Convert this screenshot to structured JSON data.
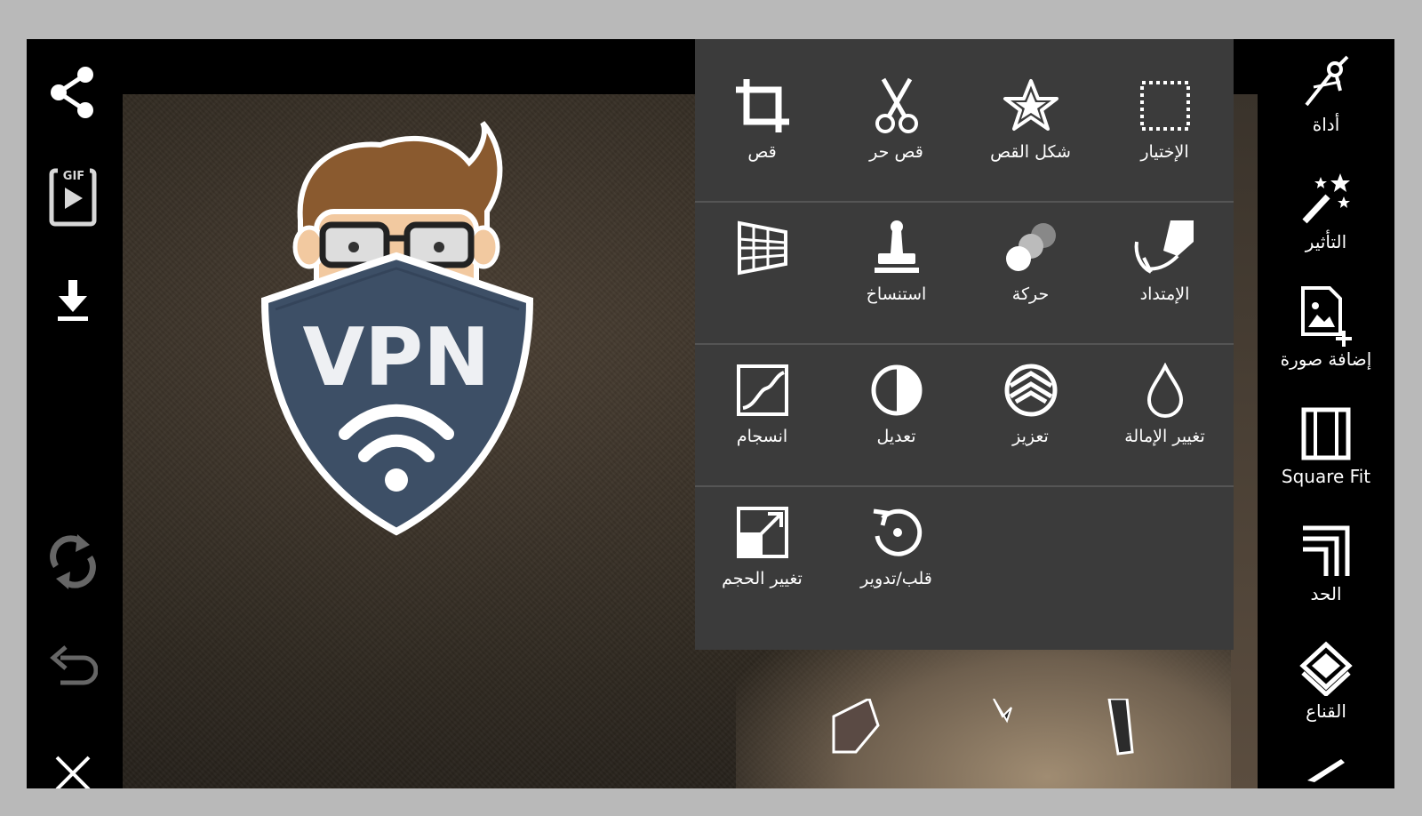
{
  "left_toolbar": {
    "buttons": [
      {
        "icon": "share-icon"
      },
      {
        "icon": "gif-icon",
        "badge": "GIF"
      },
      {
        "icon": "download-icon"
      },
      {
        "icon": "refresh-icon"
      },
      {
        "icon": "undo-icon"
      },
      {
        "icon": "close-icon"
      }
    ]
  },
  "sticker": {
    "text": "VPN"
  },
  "menu": {
    "rows": [
      [
        {
          "icon": "crop-icon",
          "label": "قص"
        },
        {
          "icon": "scissors-icon",
          "label": "قص حر"
        },
        {
          "icon": "star-icon",
          "label": "شكل القص"
        },
        {
          "icon": "selection-icon",
          "label": "الإختيار"
        }
      ],
      [
        {
          "icon": "perspective-grid-icon",
          "label": ""
        },
        {
          "icon": "stamp-icon",
          "label": "استنساخ"
        },
        {
          "icon": "motion-icon",
          "label": "حركة"
        },
        {
          "icon": "stretch-icon",
          "label": "الإمتداد"
        }
      ],
      [
        {
          "icon": "curves-icon",
          "label": "انسجام"
        },
        {
          "icon": "contrast-icon",
          "label": "تعديل"
        },
        {
          "icon": "enhance-icon",
          "label": "تعزيز"
        },
        {
          "icon": "tilt-shift-drop-icon",
          "label": "تغيير الإمالة"
        }
      ],
      [
        {
          "icon": "resize-icon",
          "label": "تغيير الحجم"
        },
        {
          "icon": "rotate-icon",
          "label": "قلب/تدوير"
        }
      ]
    ]
  },
  "right_toolbar": {
    "items": [
      {
        "icon": "compass-tool-icon",
        "label": "أداة"
      },
      {
        "icon": "magic-wand-icon",
        "label": "التأثير"
      },
      {
        "icon": "add-image-icon",
        "label": "إضافة صورة"
      },
      {
        "icon": "square-fit-icon",
        "label": "Square Fit"
      },
      {
        "icon": "border-icon",
        "label": "الحد"
      },
      {
        "icon": "mask-icon",
        "label": "القناع"
      },
      {
        "icon": "brush-icon",
        "label": ""
      }
    ]
  }
}
